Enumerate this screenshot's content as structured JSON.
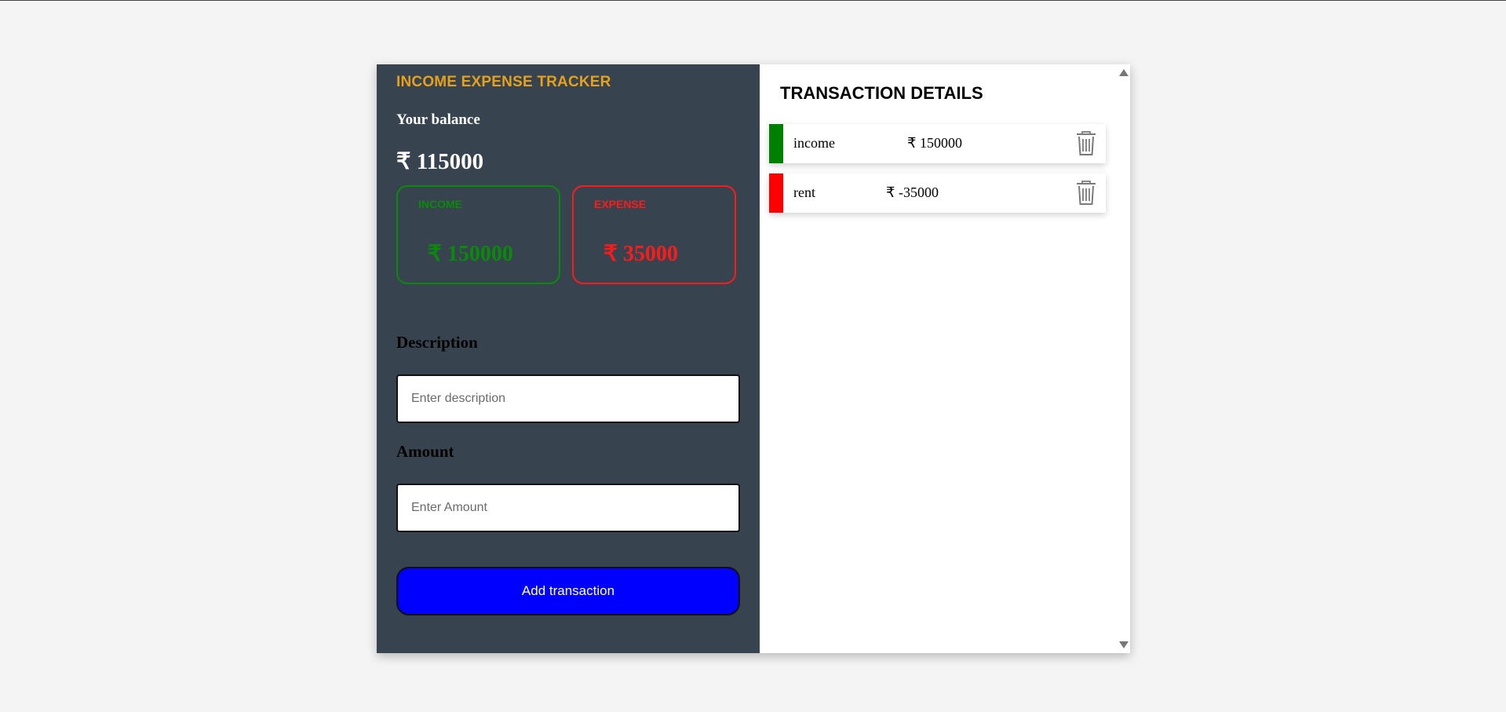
{
  "app": {
    "title": "INCOME EXPENSE TRACKER",
    "balance_label": "Your balance",
    "balance_value": "₹ 115000"
  },
  "summary": {
    "income_label": "INCOME",
    "income_value": "₹ 150000",
    "expense_label": "EXPENSE",
    "expense_value": "₹ 35000"
  },
  "form": {
    "description_label": "Description",
    "description_placeholder": "Enter description",
    "amount_label": "Amount",
    "amount_placeholder": "Enter Amount",
    "submit_label": "Add transaction"
  },
  "details": {
    "title": "TRANSACTION DETAILS",
    "transactions": [
      {
        "description": "income",
        "amount": "₹ 150000",
        "type": "income",
        "color": "#008000"
      },
      {
        "description": "rent",
        "amount": "₹ -35000",
        "type": "expense",
        "color": "#ff0000"
      }
    ]
  },
  "colors": {
    "panel_bg": "#37444f",
    "title_accent": "#e6a11c",
    "income": "#0a8a0a",
    "expense": "#ff1a1a",
    "button": "#0000ff"
  },
  "icons": {
    "delete": "trash-icon"
  }
}
